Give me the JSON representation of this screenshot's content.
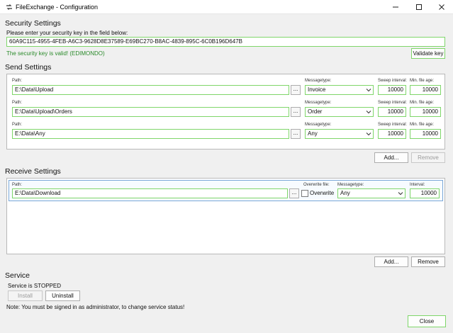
{
  "window": {
    "title": "FileExchange - Configuration",
    "minimize": "–",
    "maximize": "☐",
    "close": "✕"
  },
  "security": {
    "title": "Security Settings",
    "prompt": "Please enter your security key in the field below:",
    "key": "60A9C115-4955-4FEB-A6C3-9628D8E37589-E69BC270-B8AC-4839-895C-6C0B196D647B",
    "valid_message": "The security key is valid! (EDIMONDO)",
    "validate_label": "Validate key"
  },
  "send": {
    "title": "Send Settings",
    "path_label": "Path:",
    "messagetype_label": "Messagetype:",
    "sweep_label": "Sweep interval:",
    "minage_label": "Min. file age:",
    "rows": [
      {
        "path": "E:\\Data\\Upload",
        "messagetype": "Invoice",
        "sweep": "10000",
        "minage": "10000"
      },
      {
        "path": "E:\\Data\\Upload\\Orders",
        "messagetype": "Order",
        "sweep": "10000",
        "minage": "10000"
      },
      {
        "path": "E:\\Data\\Any",
        "messagetype": "Any",
        "sweep": "10000",
        "minage": "10000"
      }
    ],
    "add_label": "Add...",
    "remove_label": "Remove"
  },
  "receive": {
    "title": "Receive Settings",
    "path_label": "Path:",
    "overwrite_file_label": "Overwrite file:",
    "overwrite_label": "Overwrite",
    "messagetype_label": "Messagetype:",
    "interval_label": "Interval:",
    "rows": [
      {
        "path": "E:\\Data\\Download",
        "messagetype": "Any",
        "interval": "10000"
      }
    ],
    "add_label": "Add...",
    "remove_label": "Remove"
  },
  "service": {
    "title": "Service",
    "status": "Service is STOPPED",
    "install_label": "Install",
    "uninstall_label": "Uninstall",
    "note": "Note: You must be signed in as administrator, to change service status!"
  },
  "browse_label": "...",
  "close_label": "Close",
  "colors": {
    "accent_border": "#7fd66a",
    "valid_text": "#2a8a2a",
    "row_highlight": "#7aa7d8"
  }
}
